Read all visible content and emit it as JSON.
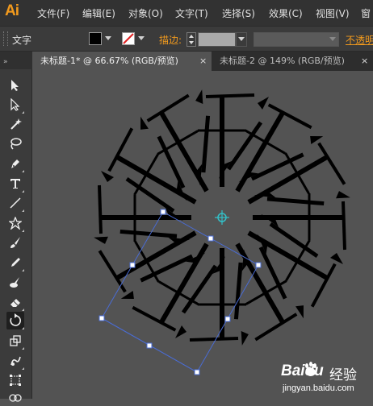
{
  "app": {
    "logo": "Ai"
  },
  "menu": [
    "文件(F)",
    "编辑(E)",
    "对象(O)",
    "文字(T)",
    "选择(S)",
    "效果(C)",
    "视图(V)",
    "窗"
  ],
  "control_bar": {
    "mode_label": "文字",
    "stroke_label": "描边:",
    "opacity_label": "不透明"
  },
  "tabs": [
    {
      "label": "未标题-1* @ 66.67% (RGB/预览)",
      "close": "×",
      "active": true
    },
    {
      "label": "未标题-2 @ 149% (RGB/预览)",
      "close": "×",
      "active": false
    }
  ],
  "tools": [
    "selection-tool-icon",
    "direct-selection-tool-icon",
    "magic-wand-icon",
    "lasso-icon",
    "pen-tool-icon",
    "type-tool-icon",
    "line-tool-icon",
    "star-tool-icon",
    "paintbrush-icon",
    "pencil-icon",
    "blob-brush-icon",
    "eraser-icon",
    "rotate-tool-icon",
    "scale-tool-icon",
    "warp-tool-icon",
    "free-transform-icon",
    "shape-builder-icon"
  ],
  "watermark": {
    "brand": "Baidu",
    "brand_cn": "经验",
    "url": "jingyan.baidu.com"
  },
  "colors": {
    "accent": "#f29a1d",
    "selection": "#4a6cd4",
    "center_point": "#33c0c8"
  }
}
